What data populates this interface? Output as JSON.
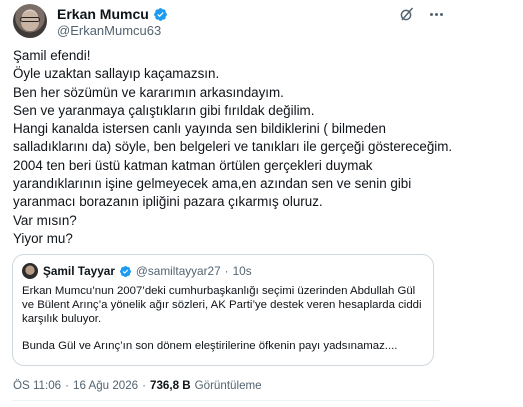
{
  "author": {
    "display_name": "Erkan Mumcu",
    "handle": "@ErkanMumcu63",
    "verified_icon": "verified-badge-icon",
    "verified_color": "#1d9bf0"
  },
  "actions": {
    "grok_icon": "grok-slash-icon",
    "more_icon": "more-dots-icon"
  },
  "tweet": {
    "lines": [
      "Şamil efendi!",
      "Öyle uzaktan sallayıp kaçamazsın.",
      "Ben her sözümün ve kararımın arkasındayım.",
      "Sen ve yaranmaya çalıştıkların gibi fırıldak değilim.",
      "Hangi kanalda istersen canlı yayında sen bildiklerini ( bilmeden salladıklarını da) söyle, ben belgeleri ve tanıkları ile gerçeği göstereceğim.",
      "2004 ten beri üstü katman katman örtülen gerçekleri duymak yarandıklarının işine gelmeyecek ama,en azından sen ve senin gibi yaranmacı borazanın ipliğini pazara çıkarmış oluruz.",
      "Var mısın?",
      "Yiyor mu?"
    ]
  },
  "quote": {
    "display_name": "Şamil Tayyar",
    "handle": "@samiltayyar27",
    "separator": "·",
    "time": "10s",
    "paragraph1": "Erkan Mumcu’nun 2007’deki cumhurbaşkanlığı seçimi üzerinden Abdullah Gül ve Bülent Arınç’a yönelik ağır sözleri, AK Parti’ye destek veren hesaplarda ciddi karşılık buluyor.",
    "paragraph2": "Bunda Gül ve Arınç’ın son dönem eleştirilerine öfkenin payı yadsınamaz...."
  },
  "meta": {
    "time": "ÖS 11:06",
    "separator1": "·",
    "date": "16 Ağu 2026",
    "separator2": "·",
    "views": "736,8 B",
    "views_label": "Görüntüleme"
  }
}
